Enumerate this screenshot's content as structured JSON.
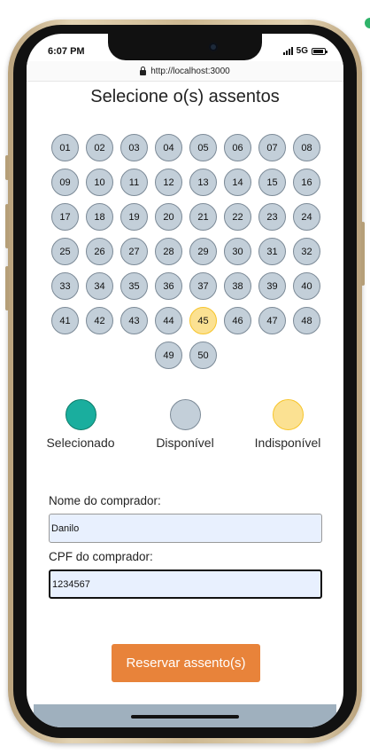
{
  "status_bar": {
    "time": "6:07 PM",
    "network": "5G"
  },
  "browser": {
    "url": "http://localhost:3000"
  },
  "page": {
    "title": "Selecione o(s) assentos"
  },
  "seats": [
    {
      "label": "01",
      "status": "available"
    },
    {
      "label": "02",
      "status": "available"
    },
    {
      "label": "03",
      "status": "available"
    },
    {
      "label": "04",
      "status": "available"
    },
    {
      "label": "05",
      "status": "available"
    },
    {
      "label": "06",
      "status": "available"
    },
    {
      "label": "07",
      "status": "available"
    },
    {
      "label": "08",
      "status": "available"
    },
    {
      "label": "09",
      "status": "available"
    },
    {
      "label": "10",
      "status": "available"
    },
    {
      "label": "11",
      "status": "available"
    },
    {
      "label": "12",
      "status": "available"
    },
    {
      "label": "13",
      "status": "available"
    },
    {
      "label": "14",
      "status": "available"
    },
    {
      "label": "15",
      "status": "available"
    },
    {
      "label": "16",
      "status": "available"
    },
    {
      "label": "17",
      "status": "available"
    },
    {
      "label": "18",
      "status": "available"
    },
    {
      "label": "19",
      "status": "available"
    },
    {
      "label": "20",
      "status": "available"
    },
    {
      "label": "21",
      "status": "available"
    },
    {
      "label": "22",
      "status": "available"
    },
    {
      "label": "23",
      "status": "available"
    },
    {
      "label": "24",
      "status": "available"
    },
    {
      "label": "25",
      "status": "available"
    },
    {
      "label": "26",
      "status": "available"
    },
    {
      "label": "27",
      "status": "available"
    },
    {
      "label": "28",
      "status": "available"
    },
    {
      "label": "29",
      "status": "available"
    },
    {
      "label": "30",
      "status": "available"
    },
    {
      "label": "31",
      "status": "available"
    },
    {
      "label": "32",
      "status": "available"
    },
    {
      "label": "33",
      "status": "available"
    },
    {
      "label": "34",
      "status": "available"
    },
    {
      "label": "35",
      "status": "available"
    },
    {
      "label": "36",
      "status": "available"
    },
    {
      "label": "37",
      "status": "available"
    },
    {
      "label": "38",
      "status": "available"
    },
    {
      "label": "39",
      "status": "available"
    },
    {
      "label": "40",
      "status": "available"
    },
    {
      "label": "41",
      "status": "available"
    },
    {
      "label": "42",
      "status": "available"
    },
    {
      "label": "43",
      "status": "available"
    },
    {
      "label": "44",
      "status": "available"
    },
    {
      "label": "45",
      "status": "unavailable"
    },
    {
      "label": "46",
      "status": "available"
    },
    {
      "label": "47",
      "status": "available"
    },
    {
      "label": "48",
      "status": "available"
    },
    {
      "label": "49",
      "status": "available"
    },
    {
      "label": "50",
      "status": "available"
    }
  ],
  "legend": [
    {
      "key": "selected",
      "label": "Selecionado",
      "fill": "#1aae9e",
      "border": "#0e7d6a"
    },
    {
      "key": "available",
      "label": "Disponível",
      "fill": "#c3cfd9",
      "border": "#7c8a97"
    },
    {
      "key": "unavailable",
      "label": "Indisponível",
      "fill": "#fbe192",
      "border": "#f7c52b"
    }
  ],
  "form": {
    "name_label": "Nome do comprador:",
    "name_value": "Danilo",
    "cpf_label": "CPF do comprador:",
    "cpf_value": "1234567"
  },
  "submit": {
    "label": "Reservar assento(s)"
  },
  "colors": {
    "accent": "#e8833a",
    "available": "#c3cfd9",
    "unavailable": "#fbe192",
    "selected": "#1aae9e"
  }
}
